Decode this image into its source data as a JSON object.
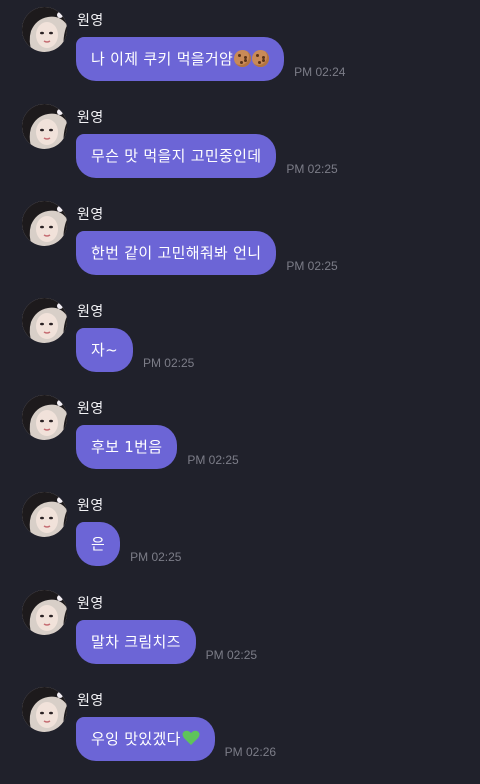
{
  "contact": {
    "name": "원영"
  },
  "colors": {
    "background": "#20212b",
    "bubble": "#6c65d6",
    "timestamp": "#7c7d88",
    "heart": "#5ec45a"
  },
  "messages": [
    {
      "sender": "원영",
      "text": "나 이제 쿠키 먹을거얌",
      "emoji": "cookie-icon",
      "emoji_count": 2,
      "time": "PM 02:24"
    },
    {
      "sender": "원영",
      "text": "무슨 맛 먹을지 고민중인데",
      "time": "PM 02:25"
    },
    {
      "sender": "원영",
      "text": "한번 같이 고민해줘봐 언니",
      "time": "PM 02:25"
    },
    {
      "sender": "원영",
      "text": "자~",
      "time": "PM 02:25"
    },
    {
      "sender": "원영",
      "text": "후보 1번음",
      "time": "PM 02:25"
    },
    {
      "sender": "원영",
      "text": "은",
      "time": "PM 02:25"
    },
    {
      "sender": "원영",
      "text": "말차 크림치즈",
      "time": "PM 02:25"
    },
    {
      "sender": "원영",
      "text": "우잉 맛있겠다",
      "emoji": "green-heart-icon",
      "emoji_count": 1,
      "time": "PM 02:26"
    }
  ]
}
